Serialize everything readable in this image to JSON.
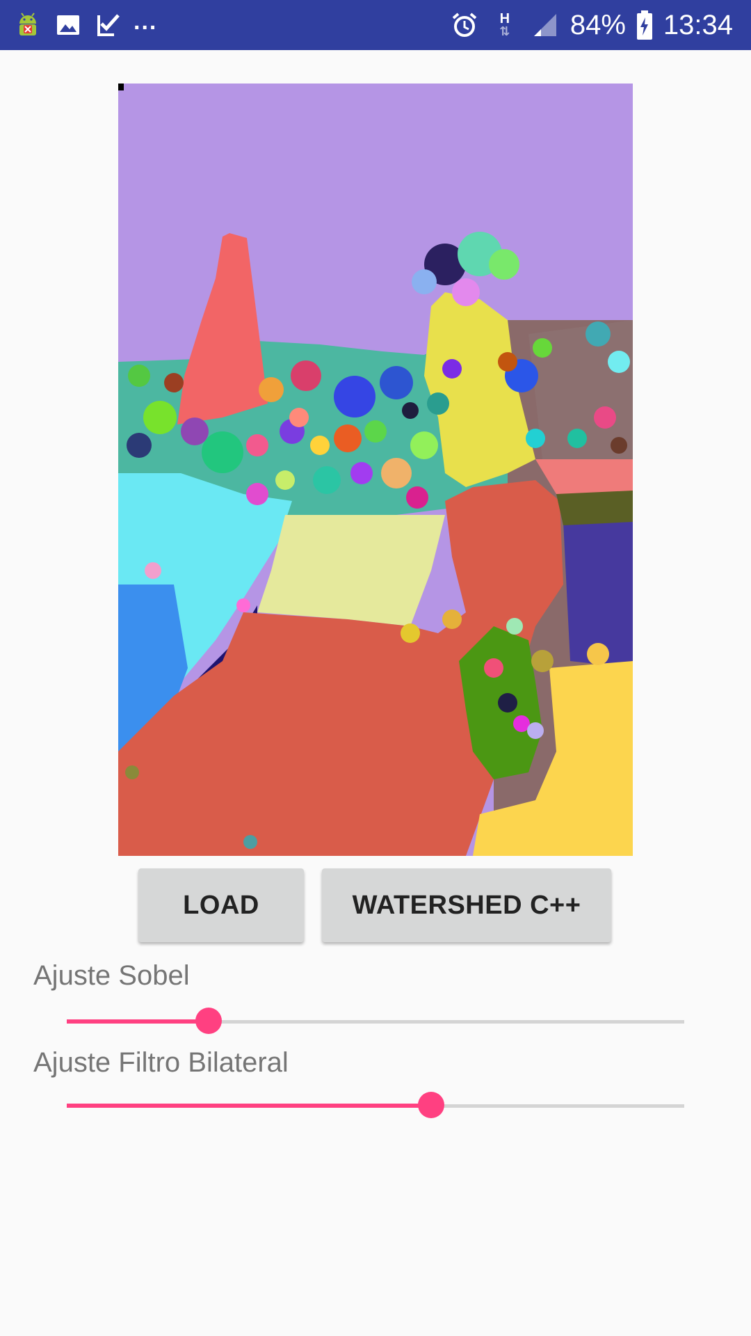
{
  "status_bar": {
    "battery": "84%",
    "time": "13:34",
    "network": "H",
    "more": "...",
    "icons": [
      "android-debug-icon",
      "image-icon",
      "check-icon",
      "alarm-icon",
      "signal-icon",
      "battery-icon"
    ],
    "color": "#303f9f"
  },
  "buttons": {
    "load_label": "LOAD",
    "watershed_label": "WATERSHED C++"
  },
  "sliders": {
    "sobel": {
      "label": "Ajuste Sobel",
      "value": 0.23
    },
    "bilateral": {
      "label": "Ajuste Filtro Bilateral",
      "value": 0.59
    }
  },
  "accent_color": "#ff4081"
}
